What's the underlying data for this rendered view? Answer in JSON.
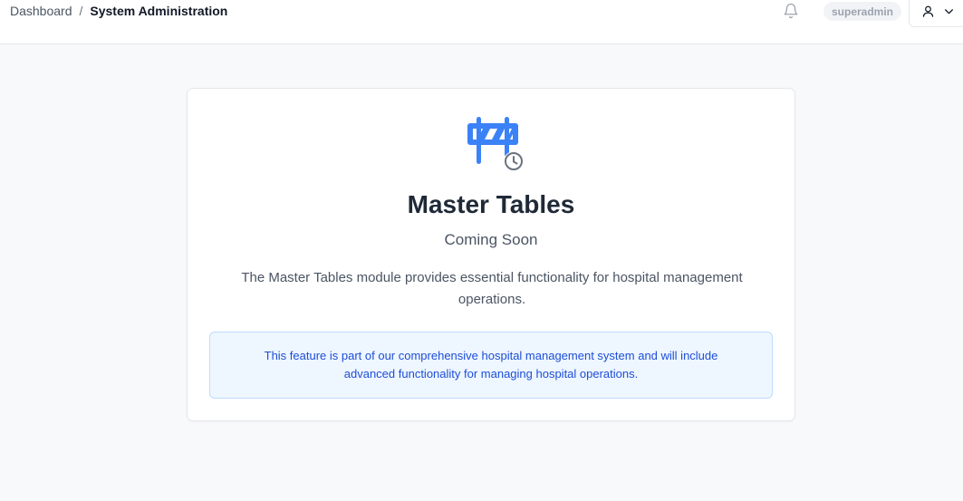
{
  "header": {
    "breadcrumb": {
      "home_label": "Dashboard",
      "separator": "/",
      "current_label": "System Administration"
    },
    "notification_icon": "bell-icon",
    "username": "superadmin",
    "user_icon": "user-icon",
    "menu_icon": "chevron-down-icon"
  },
  "content": {
    "icon": "under-construction-barrier-icon",
    "title": "Master Tables",
    "subtitle": "Coming Soon",
    "description": "The Master Tables module provides essential functionality for hospital management operations.",
    "info_text": "This feature is part of our comprehensive hospital management system and will include advanced functionality for managing hospital operations."
  },
  "colors": {
    "accent": "#3b82f6",
    "info_bg": "#eef6ff",
    "info_border": "#bfdbfe",
    "info_text": "#1d4ed8",
    "page_bg": "#f8f9fb"
  }
}
